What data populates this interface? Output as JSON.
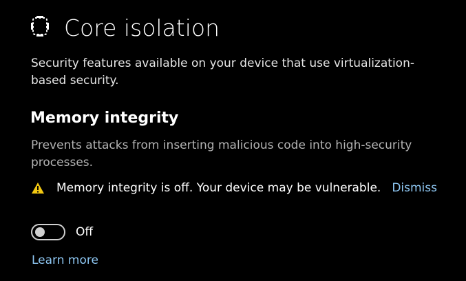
{
  "header": {
    "icon": "core-isolation-icon",
    "title": "Core isolation"
  },
  "description": "Security features available on your device that use virtualization-based security.",
  "memory_integrity": {
    "heading": "Memory integrity",
    "description": "Prevents attacks from inserting malicious code into high-security processes.",
    "warning": {
      "icon": "warning-icon",
      "icon_color": "#f2c812",
      "text": "Memory integrity is off. Your device may be vulnerable.",
      "dismiss_label": "Dismiss"
    },
    "toggle": {
      "state": false,
      "label": "Off"
    },
    "learn_more_label": "Learn more"
  },
  "colors": {
    "background": "#000000",
    "link": "#8fc8f4",
    "secondary_text": "#b3b3b3"
  }
}
